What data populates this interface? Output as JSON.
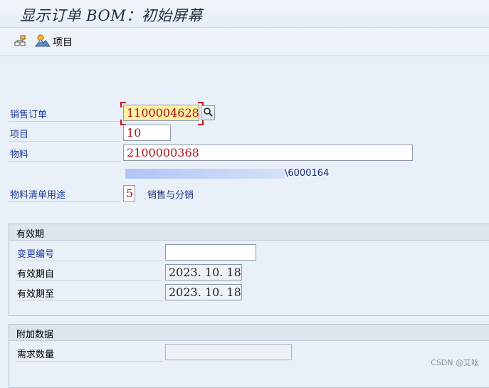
{
  "window": {
    "title": "显示订单 BOM：初始屏幕"
  },
  "toolbar": {
    "items_label": "项目"
  },
  "form": {
    "sales_order": {
      "label": "销售订单",
      "value": "1100004628"
    },
    "item": {
      "label": "项目",
      "value": "10"
    },
    "material": {
      "label": "物料",
      "value": "2100000368",
      "description": "\\6000164"
    },
    "bom_usage": {
      "label": "物料清单用途",
      "value": "5",
      "text": "销售与分销"
    }
  },
  "validity": {
    "title": "有效期",
    "change_number": {
      "label": "变更编号",
      "value": ""
    },
    "valid_from": {
      "label": "有效期自",
      "value": "2023. 10. 18"
    },
    "valid_to": {
      "label": "有效期至",
      "value": "2023. 10. 18"
    }
  },
  "additional": {
    "title": "附加数据",
    "required_qty": {
      "label": "需求数量",
      "value": ""
    }
  },
  "watermark": "CSDN @艾吆"
}
